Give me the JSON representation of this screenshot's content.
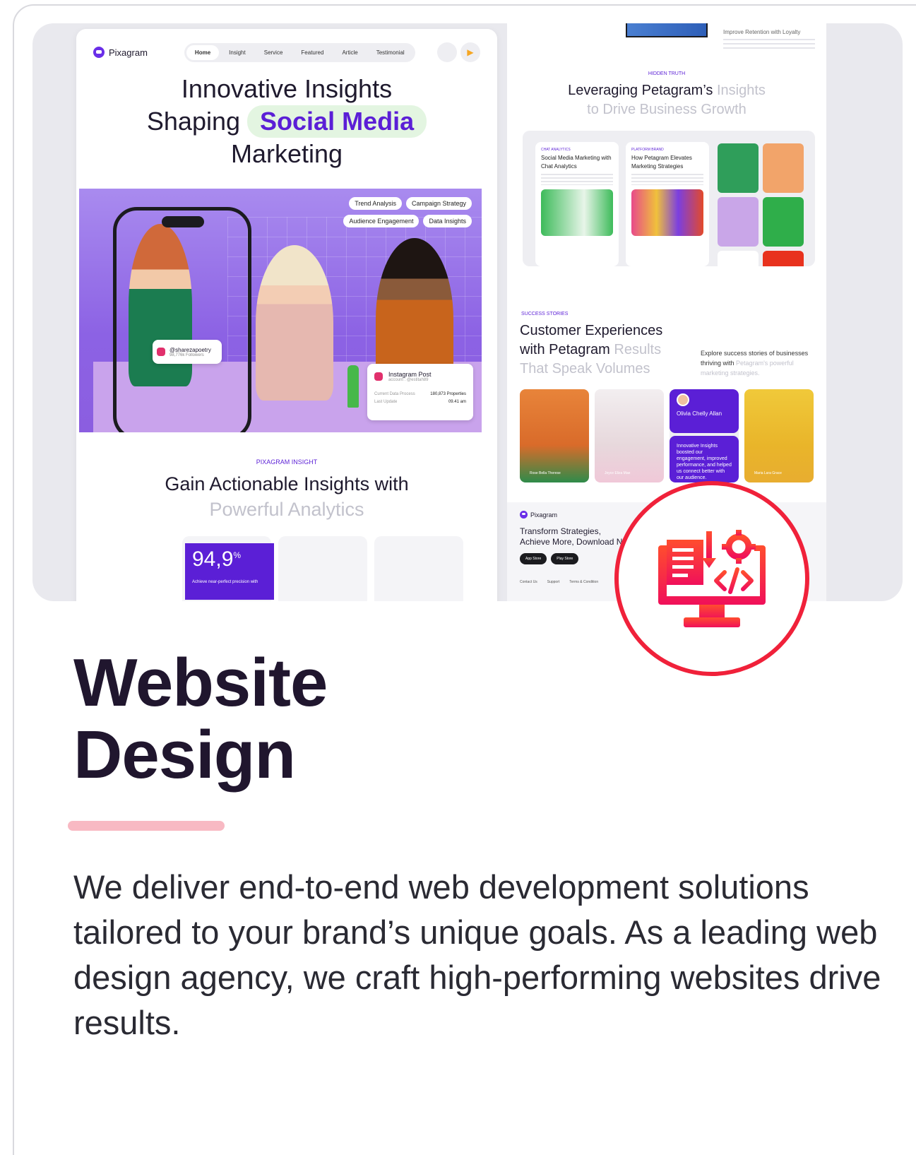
{
  "card": {
    "title_line1": "Website",
    "title_line2": "Design",
    "description": "We deliver end-to-end web development solutions tailored to your brand’s unique goals. As a leading web design agency, we craft high-performing websites drive results."
  },
  "left_mock": {
    "brand": "Pixagram",
    "nav": [
      "Home",
      "Insight",
      "Service",
      "Featured",
      "Article",
      "Testimonial"
    ],
    "hero_line1": "Innovative Insights",
    "hero_line2_a": "Shaping",
    "hero_highlight": "Social Media",
    "hero_line3": "Marketing",
    "chips": [
      "Trend Analysis",
      "Campaign Strategy",
      "Audience Engagement",
      "Data Insights"
    ],
    "social_handle": "@sharezapoetry",
    "social_followers": "98,776k Followers",
    "post_title": "Instagram Post",
    "post_account": "account : @estitah89",
    "post_row1_label": "Current Data Process",
    "post_row1_value": "180,873 Properties",
    "post_row2_label": "Last Update",
    "post_row2_value": "09.41 am",
    "section_label": "PIXAGRAM INSIGHT",
    "section_title": "Gain Actionable Insights with",
    "section_title_faint": "Powerful Analytics",
    "stat_value": "94,9",
    "stat_unit": "%",
    "stat_sub": "Achieve near-perfect precision with"
  },
  "right_mock": {
    "retention": "Improve Retention with Loyalty",
    "hidden_label": "HIDDEN TRUTH",
    "title_a": "Leveraging Petagram’s",
    "title_b": "Insights",
    "title_c": "to Drive Business Growth",
    "card1_label": "CHAT ANALYTICS",
    "card1_title": "Social Media Marketing with Chat Analytics",
    "card2_label": "PLATFORM BRAND",
    "card2_title": "How Petagram Elevates Marketing Strategies",
    "ss_label": "SUCCESS STORIES",
    "ss_title_1": "Customer Experiences",
    "ss_title_2": "with Petagram",
    "ss_title_2b": "Results",
    "ss_title_3": "That Speak Volumes",
    "ss_desc": "Explore success stories of businesses thriving with",
    "ss_desc_faint": "Petagram's powerful marketing strategies.",
    "story1": "Rose Bella Therese",
    "story2": "Joyce Eliza Mae",
    "story3_name": "Olivia Chelly Allan",
    "story3_quote": "Innovative Insights boosted our engagement, improved performance, and helped us connect better with our audience.",
    "story4": "Maria Lara Grace",
    "footer_brand": "Pixagram",
    "footer_head_1": "Transform Strategies,",
    "footer_head_2": "Achieve More, Download Now",
    "store_app": "App Store",
    "store_play": "Play Store",
    "footer_links": [
      "Contact Us",
      "Support",
      "Terms & Condition"
    ]
  },
  "icons": {
    "badge": "web-development-monitor-icon"
  },
  "colors": {
    "brand_purple": "#5b1fd6",
    "accent_red": "#f0213a",
    "accent_pink": "#f8b9c3"
  }
}
